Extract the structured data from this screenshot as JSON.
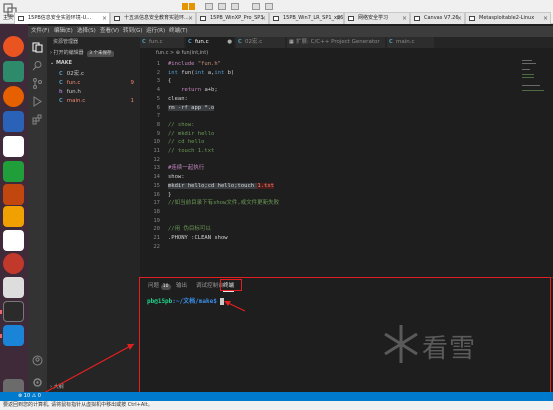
{
  "vm": {
    "tabs": [
      {
        "label": "15PB信息安全实验环境-U...",
        "active": true
      },
      {
        "label": "十五派信息安全教育实验环...",
        "active": false
      },
      {
        "label": "15PB_WinXP_Pro_SP3",
        "active": false
      },
      {
        "label": "15PB_Win7_LR_SP1_x86",
        "active": false
      },
      {
        "label": "网络安全学习",
        "active": false
      },
      {
        "label": "Canvas V7.26",
        "active": false
      },
      {
        "label": "Metasploitable2-Linux",
        "active": false
      }
    ],
    "home_label": "主页"
  },
  "menubar": [
    "文件(F)",
    "编辑(E)",
    "选择(S)",
    "查看(V)",
    "转到(G)",
    "运行(R)",
    "终端(T)"
  ],
  "sidebar": {
    "title": "资源管理器",
    "open_editors_label": "打开的编辑器",
    "unsaved_badge": "3 个未保存",
    "folder_name": "MAKE",
    "files": [
      {
        "name": "02宏.c",
        "type": "c",
        "modified": false,
        "count": ""
      },
      {
        "name": "fun.c",
        "type": "c",
        "modified": true,
        "count": "9"
      },
      {
        "name": "fun.h",
        "type": "h",
        "modified": false,
        "count": ""
      },
      {
        "name": "main.c",
        "type": "c",
        "modified": true,
        "count": "1"
      }
    ],
    "outline_label": "大纲"
  },
  "editor_tabs": [
    {
      "label": "fun.c",
      "active": false
    },
    {
      "label": "fun.c",
      "active": true
    },
    {
      "label": "02宏.c",
      "active": false
    },
    {
      "label": "扩展: C/C++ Project Generator",
      "active": false
    },
    {
      "label": "main.c",
      "active": false
    }
  ],
  "breadcrumb": "fun.c > ⊕ fun(int,int)",
  "code": [
    {
      "n": "1",
      "parts": [
        {
          "t": "#include ",
          "c": "k-pre"
        },
        {
          "t": "\"fun.h\"",
          "c": "k-str"
        }
      ]
    },
    {
      "n": "2",
      "parts": [
        {
          "t": "int ",
          "c": "k-type"
        },
        {
          "t": "fun(",
          "c": ""
        },
        {
          "t": "int ",
          "c": "k-type"
        },
        {
          "t": "a,",
          "c": ""
        },
        {
          "t": "int ",
          "c": "k-type"
        },
        {
          "t": "b)",
          "c": ""
        }
      ]
    },
    {
      "n": "3",
      "parts": [
        {
          "t": "{",
          "c": ""
        }
      ]
    },
    {
      "n": "4",
      "parts": [
        {
          "t": "    return ",
          "c": "k-pre"
        },
        {
          "t": "a+b;",
          "c": ""
        }
      ]
    },
    {
      "n": "5",
      "parts": [
        {
          "t": "clean:",
          "c": ""
        }
      ]
    },
    {
      "n": "6",
      "parts": [
        {
          "t": "rm -rf app *.o",
          "c": "hl-gray"
        }
      ]
    },
    {
      "n": "7",
      "parts": []
    },
    {
      "n": "8",
      "parts": [
        {
          "t": "// show:",
          "c": "k-comment"
        }
      ]
    },
    {
      "n": "9",
      "parts": [
        {
          "t": "// mkdir hello",
          "c": "k-comment"
        }
      ]
    },
    {
      "n": "10",
      "parts": [
        {
          "t": "// cd hello",
          "c": "k-comment"
        }
      ]
    },
    {
      "n": "11",
      "parts": [
        {
          "t": "// touch 1.txt",
          "c": "k-comment"
        }
      ]
    },
    {
      "n": "12",
      "parts": []
    },
    {
      "n": "13",
      "parts": [
        {
          "t": "#连续一起执行",
          "c": "k-pre"
        }
      ]
    },
    {
      "n": "14",
      "parts": [
        {
          "t": "show:",
          "c": ""
        }
      ]
    },
    {
      "n": "15",
      "parts": [
        {
          "t": "mkdir hello;cd hello;touch ",
          "c": "hl-gray"
        },
        {
          "t": "1.txt",
          "c": "hl-red"
        }
      ]
    },
    {
      "n": "16",
      "parts": [
        {
          "t": "}",
          "c": ""
        }
      ]
    },
    {
      "n": "17",
      "parts": [
        {
          "t": "//如当前目录下有show文件,或文件更新失败",
          "c": "k-comment"
        }
      ]
    },
    {
      "n": "18",
      "parts": []
    },
    {
      "n": "19",
      "parts": []
    },
    {
      "n": "20",
      "parts": [
        {
          "t": "//用 伪目标可以",
          "c": "k-comment"
        }
      ]
    },
    {
      "n": "21",
      "parts": [
        {
          "t": ".PHONY :CLEAN show",
          "c": ""
        }
      ]
    },
    {
      "n": "22",
      "parts": []
    }
  ],
  "panel": {
    "tabs": [
      {
        "label": "问题",
        "badge": "10",
        "active": false
      },
      {
        "label": "输出",
        "badge": "",
        "active": false
      },
      {
        "label": "调试控制台",
        "badge": "",
        "active": false
      },
      {
        "label": "终端",
        "badge": "",
        "active": true
      }
    ],
    "prompt_user": "pb@15pb",
    "prompt_path": ":~/文档/make$ "
  },
  "statusbar": {
    "problems": "⊗ 10 ⚠ 0"
  },
  "hint": "要返回到您的计算机, 请将鼠标指针从虚拟机中移出或按 Ctrl+Alt。",
  "watermark": "看雪",
  "colors": {
    "accent": "#007acc",
    "annotation": "#e02020",
    "dock": "#3f2a3a"
  }
}
